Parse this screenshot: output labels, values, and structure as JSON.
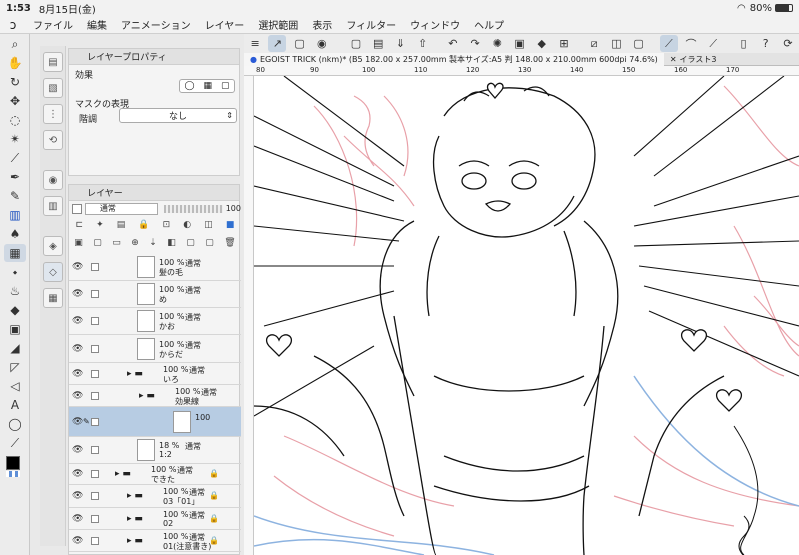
{
  "status": {
    "time": "1:53",
    "date": "8月15日(金)",
    "battery": "80%"
  },
  "menu": [
    "ファイル",
    "編集",
    "アニメーション",
    "レイヤー",
    "選択範囲",
    "表示",
    "フィルター",
    "ウィンドウ",
    "ヘルプ"
  ],
  "tabs": [
    {
      "label": "EGOIST TRICK (nkm)* (B5 182.00 x 257.00mm 製本サイズ:A5 判 148.00 x 210.00mm 600dpi 74.6%)"
    },
    {
      "label": "イラスト3"
    }
  ],
  "ruler_ticks": [
    "80",
    "90",
    "100",
    "110",
    "120",
    "130",
    "140",
    "150",
    "160",
    "170"
  ],
  "property_panel": {
    "title": "レイヤープロパティ",
    "effect_label": "効果",
    "mask_label": "マスクの表現",
    "tone_label": "階調",
    "tone_value": "なし"
  },
  "layer_panel": {
    "title": "レイヤー",
    "blend_mode": "通常",
    "opacity": "100"
  },
  "layers": [
    {
      "pct": "100 %",
      "mode": "通常",
      "name": "髪の毛",
      "indent": 0
    },
    {
      "pct": "100 %",
      "mode": "通常",
      "name": "め",
      "indent": 0
    },
    {
      "pct": "100 %",
      "mode": "通常",
      "name": "かお",
      "indent": 0
    },
    {
      "pct": "100 %",
      "mode": "通常",
      "name": "からだ",
      "indent": 0
    },
    {
      "pct": "100 %",
      "mode": "通常",
      "name": "いろ",
      "indent": 1
    },
    {
      "pct": "100 %",
      "mode": "通常",
      "name": "効果線",
      "indent": 2
    },
    {
      "pct": "100",
      "mode": "",
      "name": "",
      "indent": 3
    },
    {
      "pct": "18 %",
      "mode": "通常",
      "name": "1:2",
      "indent": 0
    },
    {
      "pct": "100 %",
      "mode": "通常",
      "name": "できた",
      "indent": 0
    },
    {
      "pct": "100 %",
      "mode": "通常",
      "name": "03「01」",
      "indent": 1
    },
    {
      "pct": "100 %",
      "mode": "通常",
      "name": "02",
      "indent": 1
    },
    {
      "pct": "100 %",
      "mode": "通常",
      "name": "01(注意書き)",
      "indent": 1
    }
  ],
  "colors": {
    "selected_row": "#b7cce3",
    "panel_bg": "#f4f4f4",
    "toolbar_bg": "#ececec",
    "sketch_pink": "#e8a0a8",
    "sketch_blue": "#8db3e0"
  }
}
